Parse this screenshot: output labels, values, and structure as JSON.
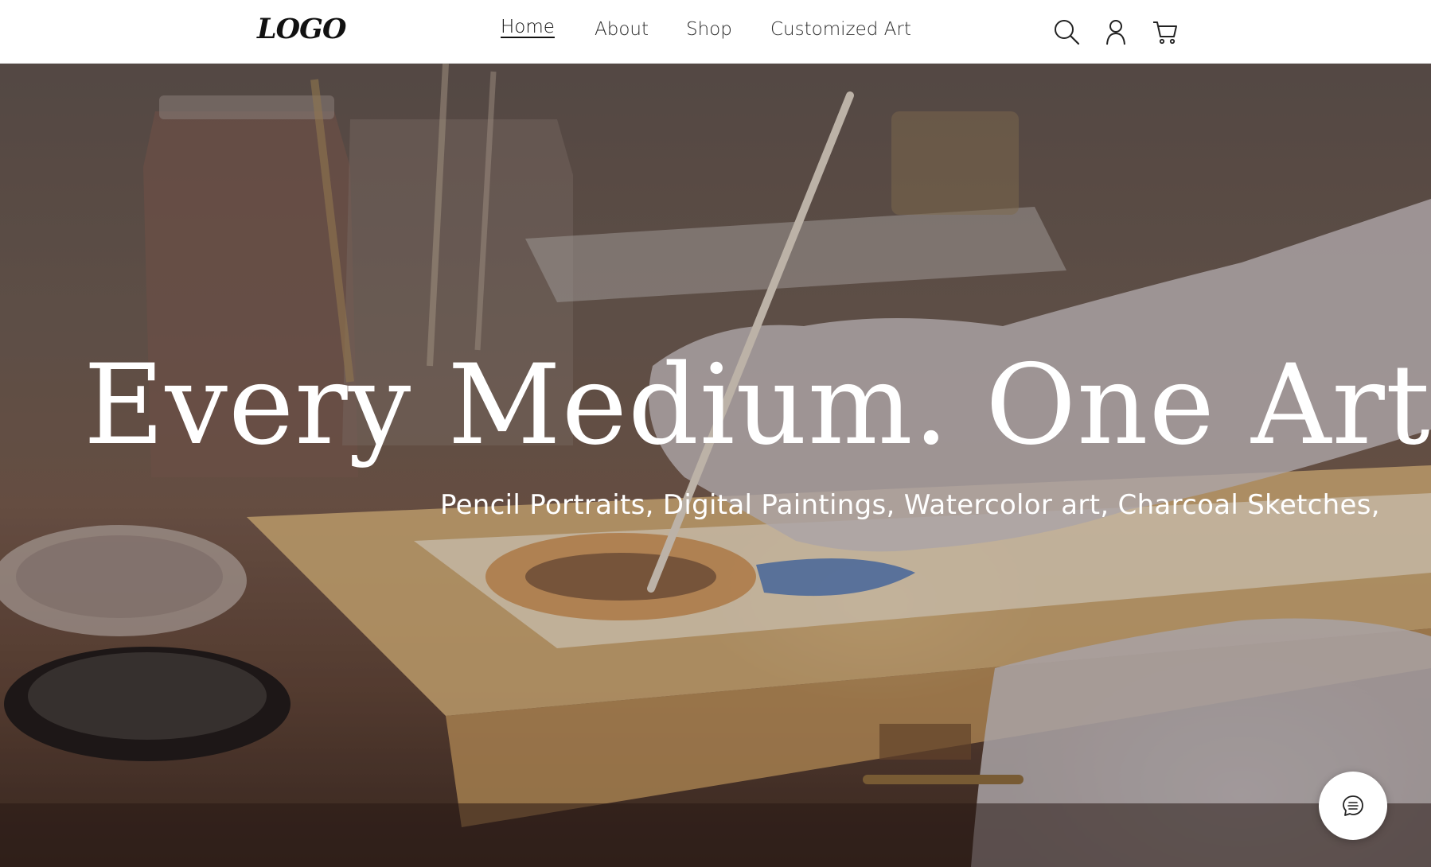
{
  "header": {
    "logo_text": "LOGO",
    "nav": [
      {
        "label": "Home",
        "active": true
      },
      {
        "label": "About",
        "active": false
      },
      {
        "label": "Shop",
        "active": false
      },
      {
        "label": "Customized Art",
        "active": false
      }
    ],
    "icons": [
      "search-icon",
      "account-icon",
      "cart-icon"
    ]
  },
  "hero": {
    "title": "Every Medium. One Artist",
    "subtitle": "Pencil Portraits, Digital Paintings, Watercolor art, Charcoal Sketches,",
    "background": "photo-of-artist-painting-icon-with-gloved-hand"
  },
  "chat": {
    "icon": "chat-icon"
  },
  "colors": {
    "header_bg": "#ffffff",
    "text_dark": "#111111",
    "hero_text": "#ffffff"
  }
}
